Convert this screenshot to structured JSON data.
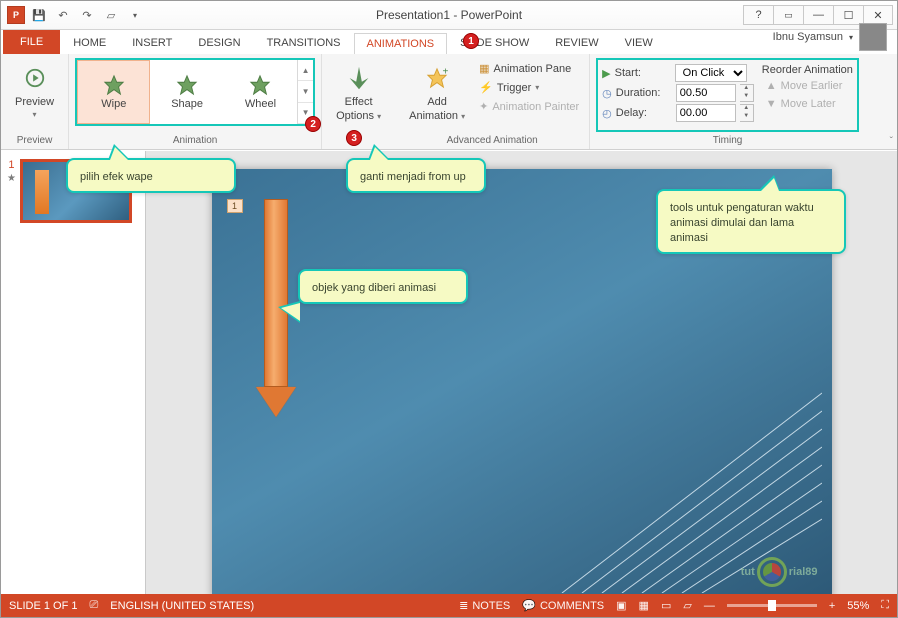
{
  "title": "Presentation1 - PowerPoint",
  "tabs": {
    "file": "FILE",
    "home": "HOME",
    "insert": "INSERT",
    "design": "DESIGN",
    "transitions": "TRANSITIONS",
    "animations": "ANIMATIONS",
    "slideshow": "SLIDE SHOW",
    "review": "REVIEW",
    "view": "VIEW"
  },
  "account": {
    "name": "Ibnu Syamsun"
  },
  "ribbon": {
    "preview": {
      "label": "Preview",
      "group": "Preview"
    },
    "animation": {
      "group": "Animation",
      "items": [
        "Wipe",
        "Shape",
        "Wheel"
      ]
    },
    "effect": {
      "label": "Effect",
      "label2": "Options"
    },
    "advanced": {
      "group": "Advanced Animation",
      "add": "Add",
      "add2": "Animation",
      "pane": "Animation Pane",
      "trigger": "Trigger",
      "painter": "Animation Painter"
    },
    "timing": {
      "group": "Timing",
      "start_lbl": "Start:",
      "start_val": "On Click",
      "duration_lbl": "Duration:",
      "duration_val": "00.50",
      "delay_lbl": "Delay:",
      "delay_val": "00.00"
    },
    "reorder": {
      "title": "Reorder Animation",
      "earlier": "Move Earlier",
      "later": "Move Later"
    }
  },
  "callouts": {
    "c1": "pilih efek wape",
    "c2": "ganti menjadi from up",
    "c3": "objek yang diberi animasi",
    "c4": "tools untuk pengaturan waktu animasi dimulai dan lama animasi"
  },
  "slide_tag": "1",
  "watermark": {
    "pre": "tut",
    "post": "rial89"
  },
  "thumb": {
    "num": "1"
  },
  "status": {
    "slide": "SLIDE 1 OF 1",
    "lang": "ENGLISH (UNITED STATES)",
    "notes": "NOTES",
    "comments": "COMMENTS",
    "zoom": "55%"
  }
}
